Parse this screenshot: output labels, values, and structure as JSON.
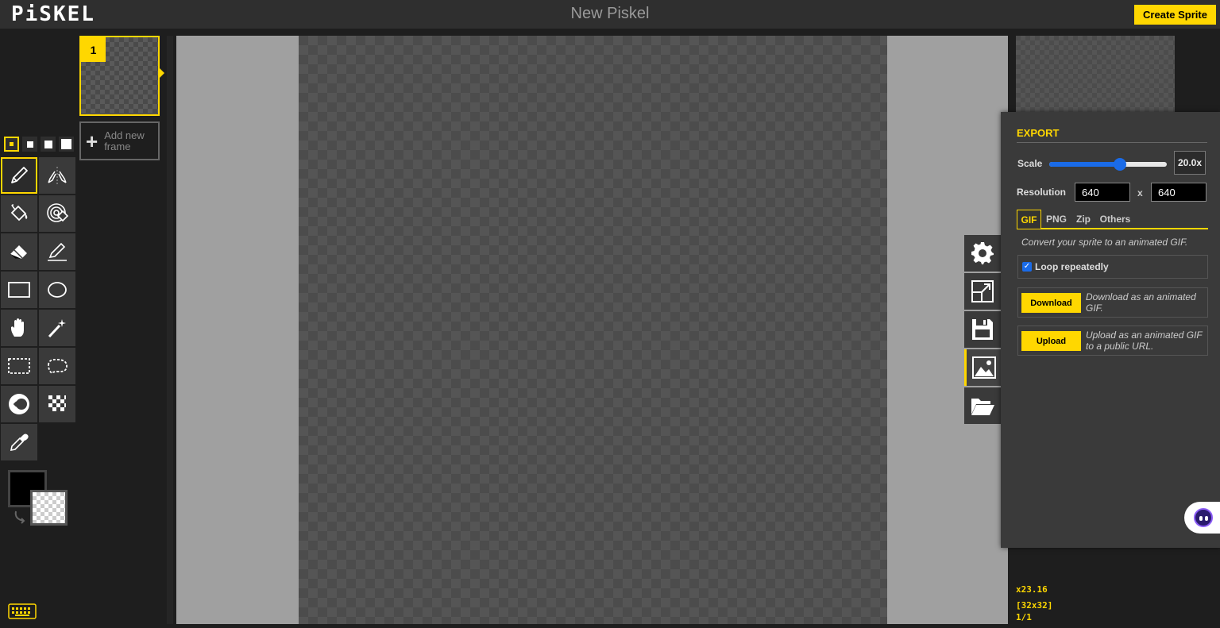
{
  "header": {
    "logo": "PiSKEL",
    "title": "New Piskel",
    "create_label": "Create Sprite"
  },
  "frames": {
    "current_number": "1",
    "add_label_line1": "Add new",
    "add_label_line2": "frame"
  },
  "tools": [
    {
      "name": "pen-tool",
      "icon": "pen-icon",
      "selected": true
    },
    {
      "name": "vertical-mirror-pen-tool",
      "icon": "mirror-pen-icon"
    },
    {
      "name": "paint-bucket-tool",
      "icon": "bucket-icon"
    },
    {
      "name": "paint-same-color-tool",
      "icon": "target-bucket-icon"
    },
    {
      "name": "eraser-tool",
      "icon": "eraser-icon"
    },
    {
      "name": "stroke-tool",
      "icon": "line-pen-icon"
    },
    {
      "name": "rectangle-tool",
      "icon": "rectangle-icon"
    },
    {
      "name": "circle-tool",
      "icon": "circle-icon"
    },
    {
      "name": "move-tool",
      "icon": "hand-icon"
    },
    {
      "name": "shape-selection-tool",
      "icon": "magic-wand-icon"
    },
    {
      "name": "rectangle-selection-tool",
      "icon": "rect-select-icon"
    },
    {
      "name": "lasso-selection-tool",
      "icon": "lasso-icon"
    },
    {
      "name": "lighten-tool",
      "icon": "lighten-icon"
    },
    {
      "name": "dithering-tool",
      "icon": "checker-icon"
    },
    {
      "name": "color-picker-tool",
      "icon": "eyedropper-icon"
    }
  ],
  "colors": {
    "primary": "#000000",
    "secondary": "transparent",
    "accent": "#ffd700"
  },
  "export": {
    "title": "EXPORT",
    "scale_label": "Scale",
    "scale_value": "20.0x",
    "scale_fraction": 0.6,
    "resolution_label": "Resolution",
    "width": "640",
    "x_label": "x",
    "height": "640",
    "tabs": [
      "GIF",
      "PNG",
      "Zip",
      "Others"
    ],
    "selected_tab": "GIF",
    "description": "Convert your sprite to an animated GIF.",
    "loop_label": "Loop repeatedly",
    "loop_checked": true,
    "download_label": "Download",
    "download_desc": "Download as an animated GIF.",
    "upload_label": "Upload",
    "upload_desc": "Upload as an animated GIF to a public URL."
  },
  "status": {
    "zoom": "x23.16",
    "size": "[32x32]",
    "frame": "1/1"
  }
}
